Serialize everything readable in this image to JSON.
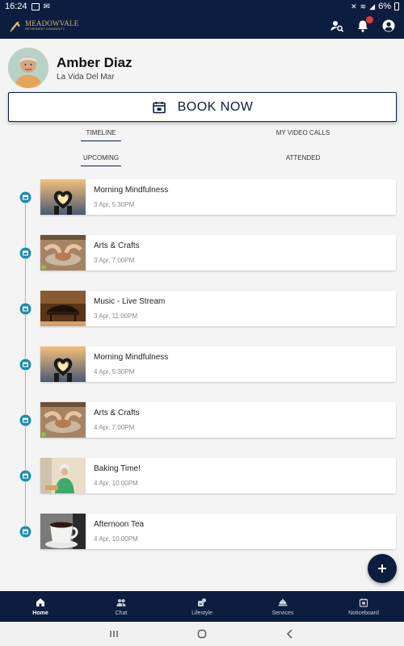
{
  "status_bar": {
    "time": "16:24",
    "battery": "6%"
  },
  "app": {
    "logo_name": "MEADOWVALE",
    "logo_tagline": "RETIREMENT COMMUNITY",
    "accent": "#0c1d40",
    "logo_gold": "#d9b863",
    "notification_badge_color": "#e53935"
  },
  "profile": {
    "name": "Amber Diaz",
    "location": "La Vida Del Mar"
  },
  "book_button": {
    "label": "BOOK NOW",
    "icon": "calendar-event-icon"
  },
  "tabs": {
    "timeline": "TIMELINE",
    "video_calls": "MY VIDEO CALLS"
  },
  "subtabs": {
    "upcoming": "UPCOMING",
    "attended": "ATTENDED"
  },
  "events": [
    {
      "title": "Morning Mindfulness",
      "time": "3 Apr, 5:30PM",
      "image": "heart-hands-sunset"
    },
    {
      "title": "Arts & Crafts",
      "time": "3 Apr, 7:00PM",
      "image": "pottery-wheel"
    },
    {
      "title": "Music - Live Stream",
      "time": "3 Apr, 11:00PM",
      "image": "grand-piano"
    },
    {
      "title": "Morning Mindfulness",
      "time": "4 Apr, 5:30PM",
      "image": "heart-hands-sunset"
    },
    {
      "title": "Arts & Crafts",
      "time": "4 Apr, 7:00PM",
      "image": "pottery-wheel"
    },
    {
      "title": "Baking Time!",
      "time": "4 Apr, 10:00PM",
      "image": "baking-woman"
    },
    {
      "title": "Afternoon Tea",
      "time": "4 Apr, 10:00PM",
      "image": "tea-cup"
    }
  ],
  "bottom_nav": [
    {
      "label": "Home",
      "icon": "home-icon",
      "active": true
    },
    {
      "label": "Chat",
      "icon": "people-icon",
      "active": false
    },
    {
      "label": "Lifestyle",
      "icon": "lifestyle-icon",
      "active": false
    },
    {
      "label": "Services",
      "icon": "cloche-icon",
      "active": false
    },
    {
      "label": "Noticeboard",
      "icon": "noticeboard-icon",
      "active": false
    }
  ]
}
